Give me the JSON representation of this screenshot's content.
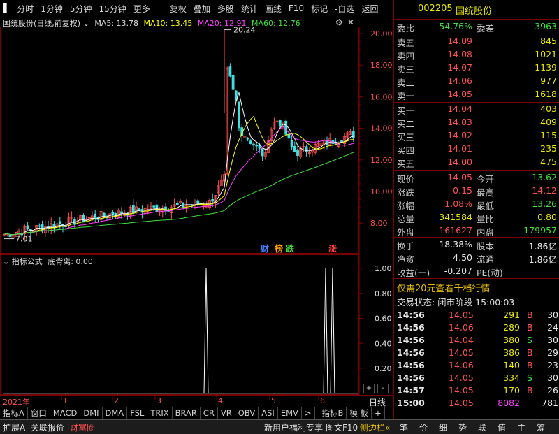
{
  "toolbar": {
    "items": [
      "分时",
      "1分钟",
      "5分钟",
      "15分钟",
      "更多"
    ],
    "items2": [
      "复权",
      "叠加",
      "多股",
      "统计",
      "画线",
      "F10",
      "标记",
      "-自选",
      "返回"
    ]
  },
  "chart_header": {
    "stock": "国统股份(日线,前复权)",
    "ma5": "MA5: 13.78",
    "ma10": "MA10: 13.45",
    "ma20": "MA20: 12.91",
    "ma60": "MA60: 12.76"
  },
  "price_axis": [
    "20.00",
    "18.00",
    "16.00",
    "14.00",
    "12.00",
    "10.00",
    "8.00"
  ],
  "annotations": {
    "high": "20.24",
    "low": "7.01",
    "badges": [
      "财",
      "榜",
      "跌",
      "涨"
    ]
  },
  "indicator": {
    "name": "指标公式",
    "label": "底背离: 0.00",
    "axis": [
      "1.00",
      "0.80",
      "0.60",
      "0.40",
      "0.20"
    ],
    "btn_plus": "+",
    "btn_minus": "-"
  },
  "time_axis": {
    "year": "2021年",
    "months": [
      "1",
      "2",
      "3",
      "4",
      "5",
      "6"
    ],
    "view": "日线"
  },
  "index_tabs": [
    "指标A",
    "窗口",
    "MACD",
    "DMI",
    "DMA",
    "FSL",
    "TRIX",
    "BRAR",
    "CR",
    "VR",
    "OBV",
    "ASI",
    "EMV",
    ">",
    "指标B",
    "模 板",
    "+"
  ],
  "status_left": [
    "扩展A",
    "关联报价",
    "财富圈"
  ],
  "status_right": [
    "新用户福利专享",
    "图文F10",
    "侧边栏«"
  ],
  "right_tabs": [
    "笔",
    "价",
    "细",
    "势",
    "联",
    "值",
    "主",
    "筹"
  ],
  "quote": {
    "code": "002205",
    "name": "国统股份",
    "weibi_label": "委比",
    "weibi": "-54.76%",
    "weicha_label": "委差",
    "weicha": "-3963",
    "asks": [
      {
        "label": "卖五",
        "price": "14.09",
        "vol": "845"
      },
      {
        "label": "卖四",
        "price": "14.08",
        "vol": "1021"
      },
      {
        "label": "卖三",
        "price": "14.07",
        "vol": "1139"
      },
      {
        "label": "卖二",
        "price": "14.06",
        "vol": "977"
      },
      {
        "label": "卖一",
        "price": "14.05",
        "vol": "1618"
      }
    ],
    "bids": [
      {
        "label": "买一",
        "price": "14.04",
        "vol": "403"
      },
      {
        "label": "买二",
        "price": "14.03",
        "vol": "409"
      },
      {
        "label": "买三",
        "price": "14.02",
        "vol": "115"
      },
      {
        "label": "买四",
        "price": "14.01",
        "vol": "235"
      },
      {
        "label": "买五",
        "price": "14.00",
        "vol": "475"
      }
    ],
    "stats": [
      {
        "l1": "现价",
        "v1": "14.05",
        "l2": "今开",
        "v2": "13.62",
        "c1": "red",
        "c2": "green"
      },
      {
        "l1": "涨跌",
        "v1": "0.15",
        "l2": "最高",
        "v2": "14.12",
        "c1": "red",
        "c2": "red"
      },
      {
        "l1": "涨幅",
        "v1": "1.08%",
        "l2": "最低",
        "v2": "13.26",
        "c1": "red",
        "c2": "green"
      },
      {
        "l1": "总量",
        "v1": "341584",
        "l2": "量比",
        "v2": "0.80",
        "c1": "yellow",
        "c2": "yellow"
      },
      {
        "l1": "外盘",
        "v1": "161627",
        "l2": "内盘",
        "v2": "179957",
        "c1": "red",
        "c2": "green"
      }
    ],
    "stats2": [
      {
        "l1": "换手",
        "v1": "18.38%",
        "l2": "股本",
        "v2": "1.86亿"
      },
      {
        "l1": "净资",
        "v1": "4.50",
        "l2": "流通",
        "v2": "1.86亿"
      },
      {
        "l1": "收益(一)",
        "v1": "-0.207",
        "l2": "PE(动)",
        "v2": ""
      }
    ],
    "promo": "仅需20元查看千档行情",
    "trade_state": "交易状态: 闭市阶段 15:00:03",
    "ticks": [
      {
        "t": "14:56",
        "p": "14.05",
        "v": "291",
        "s": "B",
        "n": "30"
      },
      {
        "t": "14:56",
        "p": "14.06",
        "v": "289",
        "s": "B",
        "n": "24"
      },
      {
        "t": "14:56",
        "p": "14.04",
        "v": "380",
        "s": "S",
        "n": "30"
      },
      {
        "t": "14:56",
        "p": "14.05",
        "v": "386",
        "s": "B",
        "n": "29"
      },
      {
        "t": "14:56",
        "p": "14.06",
        "v": "140",
        "s": "B",
        "n": "23"
      },
      {
        "t": "14:56",
        "p": "14.05",
        "v": "334",
        "s": "S",
        "n": "30"
      },
      {
        "t": "14:57",
        "p": "14.05",
        "v": "170",
        "s": "B",
        "n": "26"
      },
      {
        "t": "15:00",
        "p": "14.05",
        "v": "8082",
        "s": "",
        "n": "781"
      }
    ]
  },
  "colors": {
    "up": "#ff5050",
    "down": "#40e040",
    "ma5": "#ffffff",
    "ma10": "#ffff00",
    "ma20": "#ff40ff",
    "ma60": "#40e040",
    "frame": "#7a0000"
  }
}
